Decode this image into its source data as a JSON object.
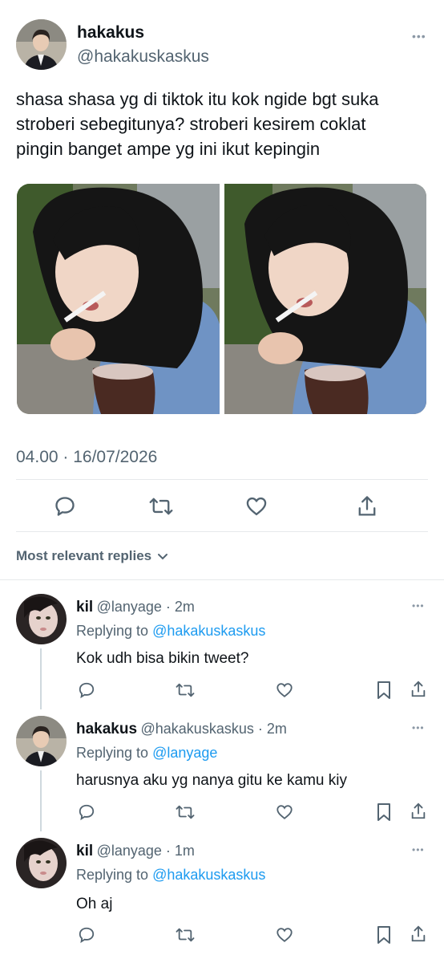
{
  "tweet": {
    "author_name": "hakakus",
    "author_handle": "@hakakuskaskus",
    "more": "•••",
    "text_line1": "shasa shasa yg di tiktok itu kok ngide bgt suka",
    "text_line2": "stroberi sebegitunya? stroberi kesirem coklat",
    "text_line3": "pingin banget ampe yg ini ikut kepingin",
    "timestamp": "04.00 · 16/07/2026",
    "actions": [
      "comment-icon",
      "retweet-icon",
      "like-icon",
      "share-icon"
    ]
  },
  "replies_header": {
    "label": "Most relevant replies",
    "chevron": "chevron-down-icon"
  },
  "replies": [
    {
      "name": "kil",
      "meta": "@lanyage · 2m",
      "replying_prefix": "Replying to ",
      "replying_to": "@hakakuskaskus",
      "text": "Kok udh bisa bikin tweet?",
      "more": "•••"
    },
    {
      "name": "hakakus",
      "meta": "@hakakuskaskus · 2m",
      "replying_prefix": "Replying to ",
      "replying_to": "@lanyage",
      "text": "harusnya aku yg nanya gitu ke kamu kiy",
      "more": "•••"
    },
    {
      "name": "kil",
      "meta": "@lanyage · 1m",
      "replying_prefix": "Replying to ",
      "replying_to": "@hakakuskaskus",
      "text": "Oh aj",
      "more": "•••"
    }
  ],
  "colors": {
    "link": "#1d9bf0",
    "text": "#0f1419",
    "secondary": "#536471",
    "divider": "#e6e9eb"
  }
}
